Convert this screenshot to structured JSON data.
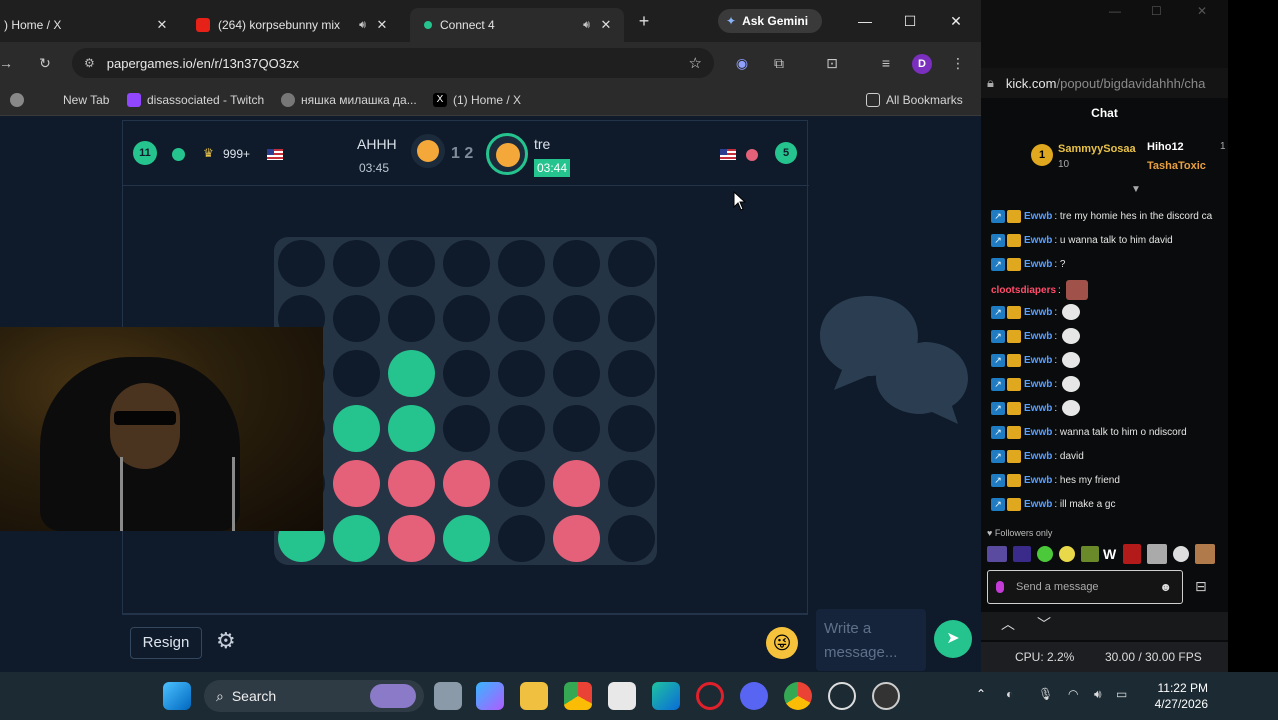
{
  "browser": {
    "tabs": [
      {
        "label": ") Home / X",
        "active": false,
        "favicon": "x-icon"
      },
      {
        "label": "(264) korpsebunny mix",
        "active": false,
        "favicon": "youtube-icon"
      },
      {
        "label": "Connect 4",
        "active": true,
        "favicon": "papergames-icon"
      }
    ],
    "new_tab": "+",
    "gemini_label": "Ask Gemini",
    "url": "papergames.io/en/r/13n37QO3zx",
    "profile_initial": "D",
    "bookmarks": [
      {
        "label": "New Tab",
        "icon": "globe-icon"
      },
      {
        "label": "disassociated - Twitch",
        "icon": "twitch-icon"
      },
      {
        "label": "няшка милашка да...",
        "icon": "globe-icon"
      },
      {
        "label": "(1) Home / X",
        "icon": "x-icon"
      }
    ],
    "all_bookmarks": "All Bookmarks"
  },
  "game": {
    "badge_left": "11",
    "crown_count": "999+",
    "player1": {
      "name": "AHHH",
      "time": "03:45"
    },
    "score": "1 2",
    "player2": {
      "name": "tre",
      "time": "03:44"
    },
    "badge_right": "5",
    "colors": {
      "green": "#25c48f",
      "pink": "#e5617a",
      "empty": "#0f1b2a",
      "board": "#243444"
    },
    "board": [
      [
        "e",
        "e",
        "e",
        "e",
        "e",
        "e",
        "e"
      ],
      [
        "e",
        "e",
        "e",
        "e",
        "e",
        "e",
        "e"
      ],
      [
        "e",
        "e",
        "g",
        "e",
        "e",
        "e",
        "e"
      ],
      [
        "e",
        "g",
        "g",
        "e",
        "e",
        "e",
        "e"
      ],
      [
        "e",
        "p",
        "p",
        "p",
        "e",
        "p",
        "e"
      ],
      [
        "g",
        "g",
        "p",
        "g",
        "e",
        "p",
        "e"
      ]
    ],
    "resign_label": "Resign",
    "chat_placeholder": "Write a message..."
  },
  "kick": {
    "url_domain": "kick.com",
    "url_path": "/popout/bigdavidahhh/cha",
    "chat_title": "Chat",
    "pinned": {
      "user1": "SammyySosaa",
      "count1": "10",
      "user2": "Hiho12",
      "user3": "TashaToxic",
      "count2": "1"
    },
    "messages": [
      {
        "user": "Ewwb",
        "text": "tre my homie hes in the discord ca"
      },
      {
        "user": "Ewwb",
        "text": "u wanna talk to him david"
      },
      {
        "user": "Ewwb",
        "text": "?"
      },
      {
        "user": "clootsdiapers",
        "text": ""
      },
      {
        "user": "Ewwb",
        "text": ""
      },
      {
        "user": "Ewwb",
        "text": ""
      },
      {
        "user": "Ewwb",
        "text": ""
      },
      {
        "user": "Ewwb",
        "text": ""
      },
      {
        "user": "Ewwb",
        "text": ""
      },
      {
        "user": "Ewwb",
        "text": "wanna talk to him o ndiscord"
      },
      {
        "user": "Ewwb",
        "text": "david"
      },
      {
        "user": "Ewwb",
        "text": "hes my friend"
      },
      {
        "user": "Ewwb",
        "text": "ill make a gc"
      }
    ],
    "followers_only": "Followers only",
    "send_placeholder": "Send a message"
  },
  "obs": {
    "cpu": "CPU: 2.2%",
    "fps": "30.00 / 30.00 FPS"
  },
  "taskbar": {
    "search": "Search",
    "time": "11:22 PM",
    "date": "4/27/2026"
  }
}
